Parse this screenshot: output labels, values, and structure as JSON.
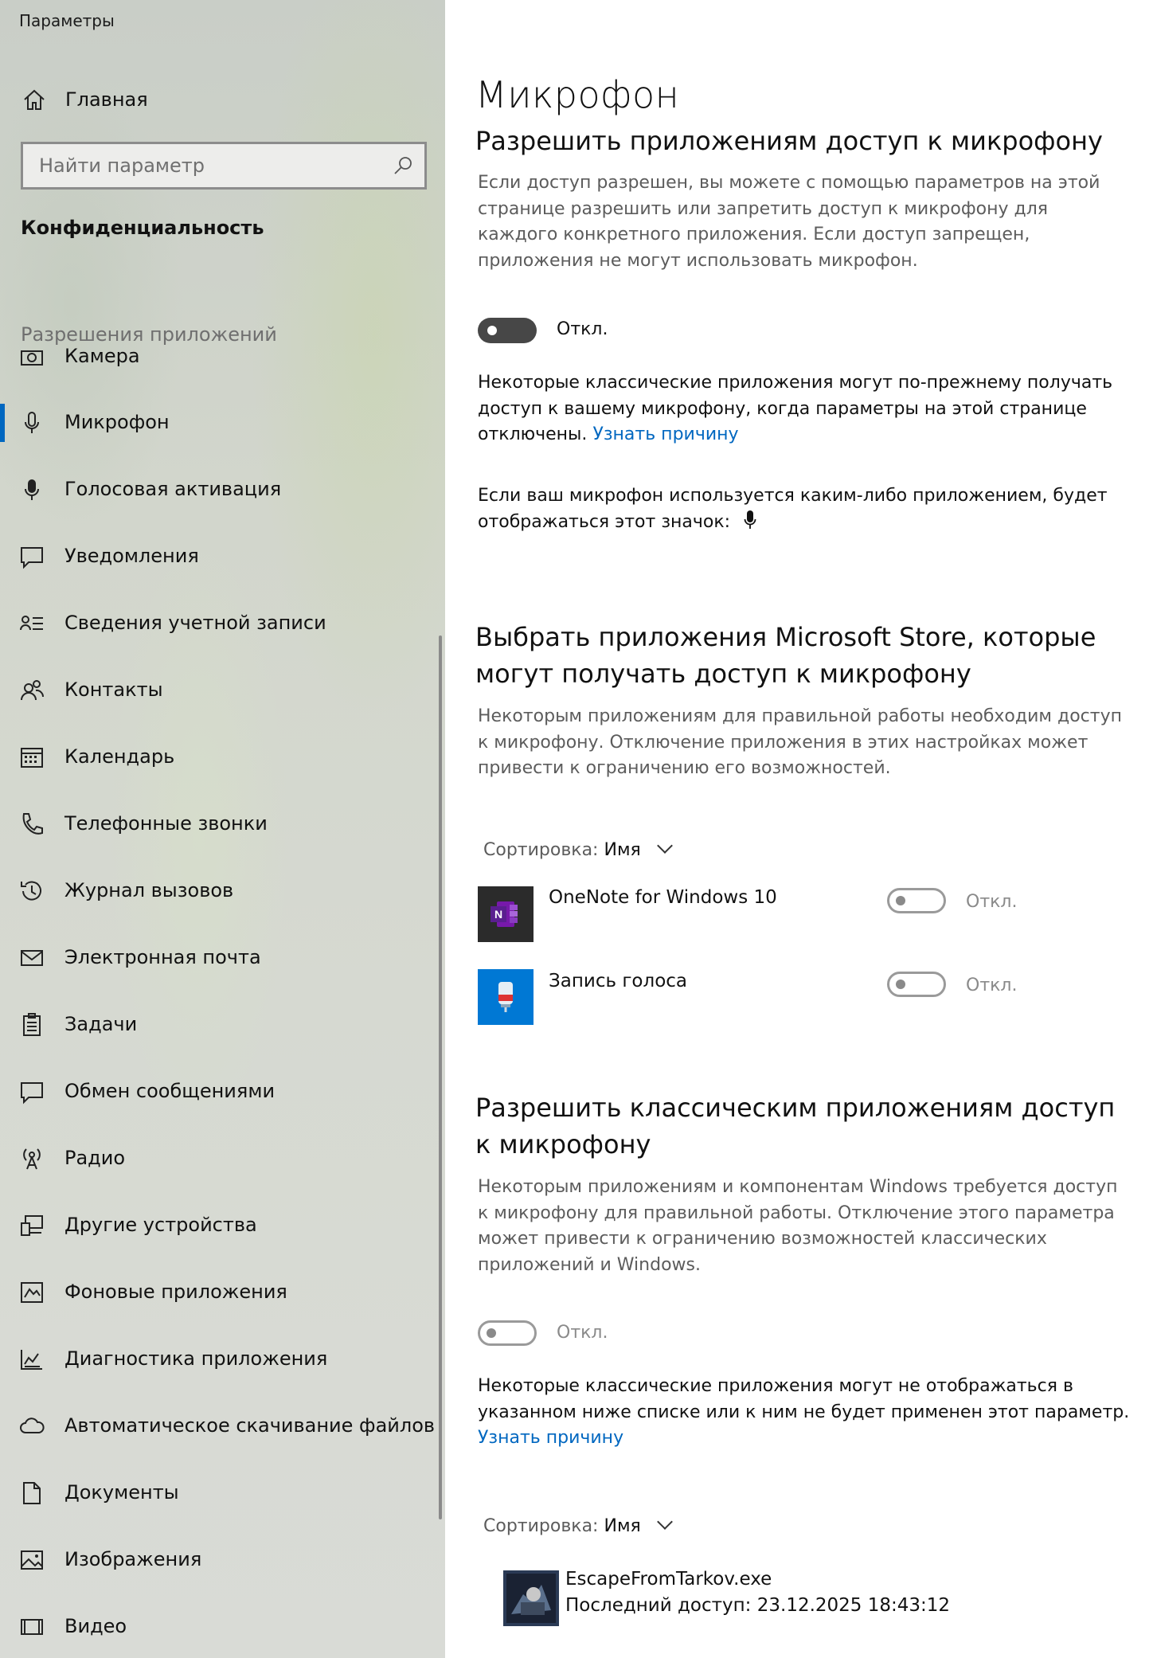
{
  "window": {
    "title": "Параметры"
  },
  "sidebar": {
    "home_label": "Главная",
    "search_placeholder": "Найти параметр",
    "section_title": "Конфиденциальность",
    "group_label": "Разрешения приложений",
    "items": [
      {
        "label": "Камера",
        "icon": "camera-icon"
      },
      {
        "label": "Микрофон",
        "icon": "microphone-icon",
        "active": true
      },
      {
        "label": "Голосовая активация",
        "icon": "voice-activation-icon"
      },
      {
        "label": "Уведомления",
        "icon": "notifications-icon"
      },
      {
        "label": "Сведения учетной записи",
        "icon": "account-info-icon"
      },
      {
        "label": "Контакты",
        "icon": "contacts-icon"
      },
      {
        "label": "Календарь",
        "icon": "calendar-icon"
      },
      {
        "label": "Телефонные звонки",
        "icon": "phone-icon"
      },
      {
        "label": "Журнал вызовов",
        "icon": "history-icon"
      },
      {
        "label": "Электронная почта",
        "icon": "mail-icon"
      },
      {
        "label": "Задачи",
        "icon": "tasks-icon"
      },
      {
        "label": "Обмен сообщениями",
        "icon": "messaging-icon"
      },
      {
        "label": "Радио",
        "icon": "radio-icon"
      },
      {
        "label": "Другие устройства",
        "icon": "other-devices-icon"
      },
      {
        "label": "Фоновые приложения",
        "icon": "background-apps-icon"
      },
      {
        "label": "Диагностика приложения",
        "icon": "app-diagnostics-icon"
      },
      {
        "label": "Автоматическое скачивание файлов",
        "icon": "cloud-icon"
      },
      {
        "label": "Документы",
        "icon": "document-icon"
      },
      {
        "label": "Изображения",
        "icon": "pictures-icon"
      },
      {
        "label": "Видео",
        "icon": "video-icon"
      }
    ]
  },
  "main": {
    "page_title": "Микрофон",
    "allow_section": {
      "heading": "Разрешить приложениям доступ к микрофону",
      "description": "Если доступ разрешен, вы можете с помощью параметров на этой странице разрешить или запретить доступ к микрофону для каждого конкретного приложения. Если доступ запрещен, приложения не могут использовать микрофон.",
      "toggle_state": "Откл.",
      "note_text": "Некоторые классические приложения могут по-прежнему получать доступ к вашему микрофону, когда параметры на этой странице отключены.",
      "note_link": "Узнать причину",
      "indicator_text": "Если ваш микрофон используется каким-либо приложением, будет отображаться этот значок:"
    },
    "store_section": {
      "heading": "Выбрать приложения Microsoft Store, которые могут получать доступ к микрофону",
      "description": "Некоторым приложениям для правильной работы необходим доступ к микрофону. Отключение приложения в этих настройках может привести к ограничению его возможностей.",
      "sort_label": "Сортировка:",
      "sort_value": "Имя",
      "apps": [
        {
          "name": "OneNote for Windows 10",
          "state": "Откл.",
          "icon": "onenote-icon",
          "color": "#7719aa"
        },
        {
          "name": "Запись голоса",
          "state": "Откл.",
          "icon": "voice-recorder-icon",
          "color": "#0078d4"
        }
      ]
    },
    "desktop_section": {
      "heading": "Разрешить классическим приложениям доступ к микрофону",
      "description": "Некоторым приложениям и компонентам Windows требуется доступ к микрофону для правильной работы. Отключение этого параметра может привести к ограничению возможностей классических приложений и Windows.",
      "toggle_state": "Откл.",
      "note_text": "Некоторые классические приложения могут не отображаться в указанном ниже списке или к ним не будет применен этот параметр.",
      "note_link": "Узнать причину",
      "sort_label": "Сортировка:",
      "sort_value": "Имя",
      "apps": [
        {
          "name": "EscapeFromTarkov.exe",
          "last_access": "Последний доступ: 23.12.2025 18:43:12"
        }
      ]
    }
  },
  "colors": {
    "accent": "#0067c0",
    "toggle_off": "#474747"
  }
}
